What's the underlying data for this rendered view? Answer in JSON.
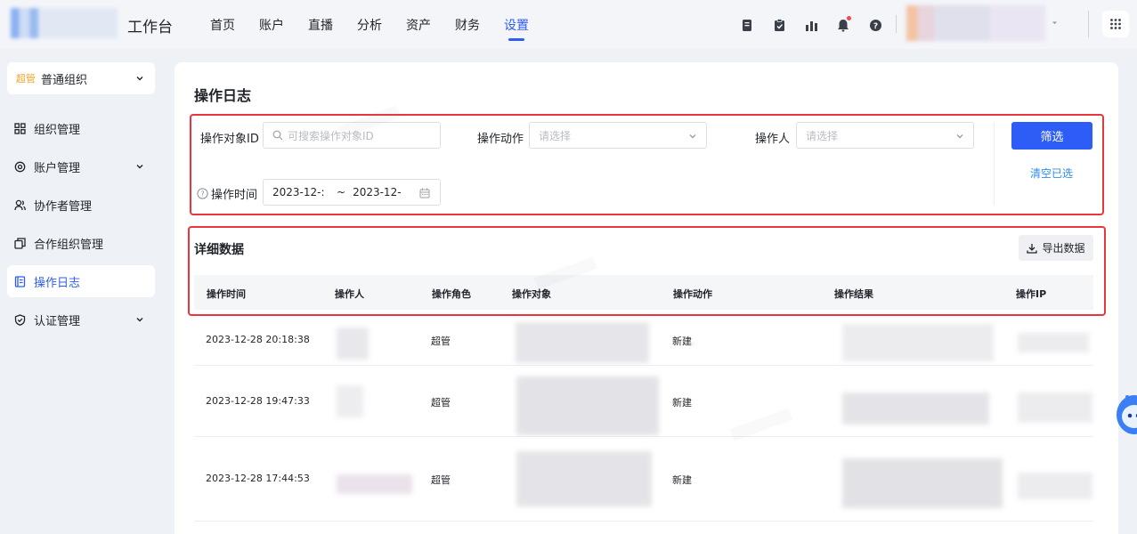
{
  "app": {
    "title": "工作台",
    "nav": [
      "首页",
      "账户",
      "直播",
      "分析",
      "资产",
      "财务",
      "设置"
    ],
    "active_nav": "设置"
  },
  "sidebar": {
    "org_tag": "超管",
    "org_name": "普通组织",
    "items": [
      {
        "label": "组织管理",
        "icon": "grid-icon",
        "has_caret": false
      },
      {
        "label": "账户管理",
        "icon": "settings-icon",
        "has_caret": true
      },
      {
        "label": "协作者管理",
        "icon": "users-icon",
        "has_caret": false
      },
      {
        "label": "合作组织管理",
        "icon": "copy-icon",
        "has_caret": false
      },
      {
        "label": "操作日志",
        "icon": "log-icon",
        "has_caret": false,
        "active": true
      },
      {
        "label": "认证管理",
        "icon": "shield-icon",
        "has_caret": true
      }
    ]
  },
  "page": {
    "title": "操作日志",
    "filters": {
      "target_id_label": "操作对象ID",
      "target_id_placeholder": "可搜索操作对象ID",
      "action_label": "操作动作",
      "action_placeholder": "请选择",
      "operator_label": "操作人",
      "operator_placeholder": "请选择",
      "time_label": "操作时间",
      "time_start": "2023-12-:",
      "time_sep": "~",
      "time_end": "2023-12-",
      "filter_button": "筛选",
      "clear_link": "清空已选"
    },
    "detail": {
      "title": "详细数据",
      "export_button": "导出数据",
      "columns": [
        "操作时间",
        "操作人",
        "操作角色",
        "操作对象",
        "操作动作",
        "操作结果",
        "操作IP"
      ],
      "rows": [
        {
          "time": "2023-12-28 20:18:38",
          "role": "超管",
          "action": "新建"
        },
        {
          "time": "2023-12-28 19:47:33",
          "role": "超管",
          "action": "新建"
        },
        {
          "time": "2023-12-28 17:44:53",
          "role": "超管",
          "action": "新建"
        }
      ]
    }
  },
  "colors": {
    "accent": "#2d5cf6",
    "link": "#2d8cf0",
    "annotation_red": "#e8363a",
    "tag_orange": "#f7a12a"
  }
}
